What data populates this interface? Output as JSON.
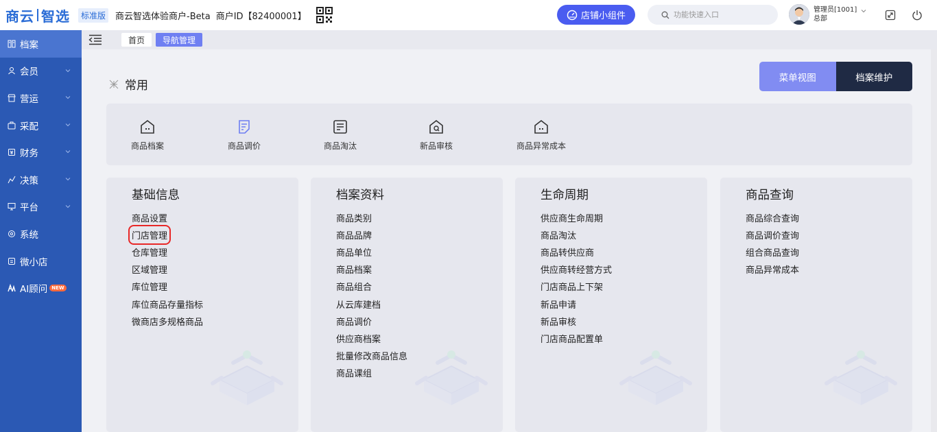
{
  "header": {
    "logo_left": "商云",
    "logo_right": "智选",
    "edition": "标准版",
    "merchant": "商云智选体验商户-Beta",
    "merchant_id": "商户ID【82400001】",
    "widget_label": "店铺小组件",
    "search_placeholder": "功能快速入口",
    "user_name": "管理员[1001]",
    "user_org": "总部"
  },
  "sidebar": {
    "items": [
      {
        "label": "档案",
        "icon": "file-icon"
      },
      {
        "label": "会员",
        "icon": "user-icon"
      },
      {
        "label": "营运",
        "icon": "shop-icon"
      },
      {
        "label": "采配",
        "icon": "purchase-icon"
      },
      {
        "label": "财务",
        "icon": "finance-icon"
      },
      {
        "label": "决策",
        "icon": "decision-icon"
      },
      {
        "label": "平台",
        "icon": "monitor-icon"
      },
      {
        "label": "系统",
        "icon": "settings-icon"
      },
      {
        "label": "微小店",
        "icon": "store-icon"
      },
      {
        "label": "AI顾问",
        "icon": "ai-icon"
      }
    ],
    "new_badge": "NEW"
  },
  "tabs": {
    "home": "首页",
    "current": "导航管理"
  },
  "main": {
    "common_title": "常用",
    "view_menu": "菜单视图",
    "view_archive": "档案维护",
    "quick_items": [
      {
        "label": "商品档案",
        "icon": "house-icon"
      },
      {
        "label": "商品调价",
        "icon": "edit-doc-icon"
      },
      {
        "label": "商品淘汰",
        "icon": "list-box-icon"
      },
      {
        "label": "新品审核",
        "icon": "search-house-icon"
      },
      {
        "label": "商品异常成本",
        "icon": "house-icon"
      }
    ],
    "cards": [
      {
        "title": "基础信息",
        "items": [
          "商品设置",
          "门店管理",
          "仓库管理",
          "区域管理",
          "库位管理",
          "库位商品存量指标",
          "微商店多规格商品"
        ]
      },
      {
        "title": "档案资料",
        "items": [
          "商品类别",
          "商品品牌",
          "商品单位",
          "商品档案",
          "商品组合",
          "从云库建档",
          "商品调价",
          "供应商档案",
          "批量修改商品信息",
          "商品课组"
        ]
      },
      {
        "title": "生命周期",
        "items": [
          "供应商生命周期",
          "商品淘汰",
          "商品转供应商",
          "供应商转经营方式",
          "门店商品上下架",
          "新品申请",
          "新品审核",
          "门店商品配置单"
        ]
      },
      {
        "title": "商品查询",
        "items": [
          "商品综合查询",
          "商品调价查询",
          "组合商品查询",
          "商品异常成本"
        ]
      }
    ]
  },
  "colors": {
    "sidebar_bg": "#2b59b4",
    "sidebar_active": "#4a75d0",
    "accent": "#4a5cf0",
    "highlight_border": "#e82727"
  }
}
